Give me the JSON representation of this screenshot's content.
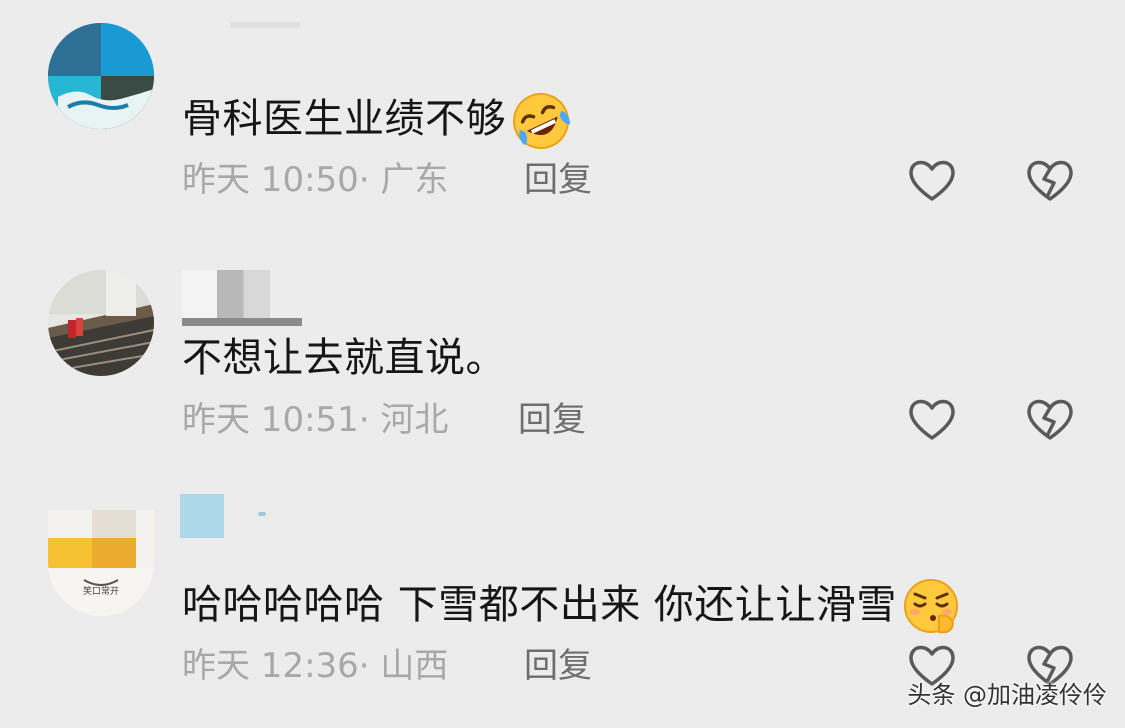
{
  "comments": [
    {
      "text": "骨科医生业绩不够",
      "emoji": "rofl-emoji",
      "meta": "昨天 10:50· 广东",
      "reply_label": "回复"
    },
    {
      "text": "不想让去就直说。",
      "emoji": "",
      "meta": "昨天 10:51· 河北",
      "reply_label": "回复"
    },
    {
      "text": "哈哈哈哈哈 下雪都不出来 你还让让滑雪",
      "emoji": "pensive-shush-emoji",
      "meta": "昨天 12:36· 山西",
      "reply_label": "回复"
    }
  ],
  "avatar3_badge_text": "笑口常开",
  "watermark": "头条 @加油凌伶伶",
  "icons": {
    "like": "heart-outline-icon",
    "dislike": "broken-heart-outline-icon"
  },
  "colors": {
    "background": "#ececec",
    "text": "#161616",
    "meta": "#a8a8a8",
    "reply": "#6e6e6e",
    "icon": "#5a5a5a"
  }
}
